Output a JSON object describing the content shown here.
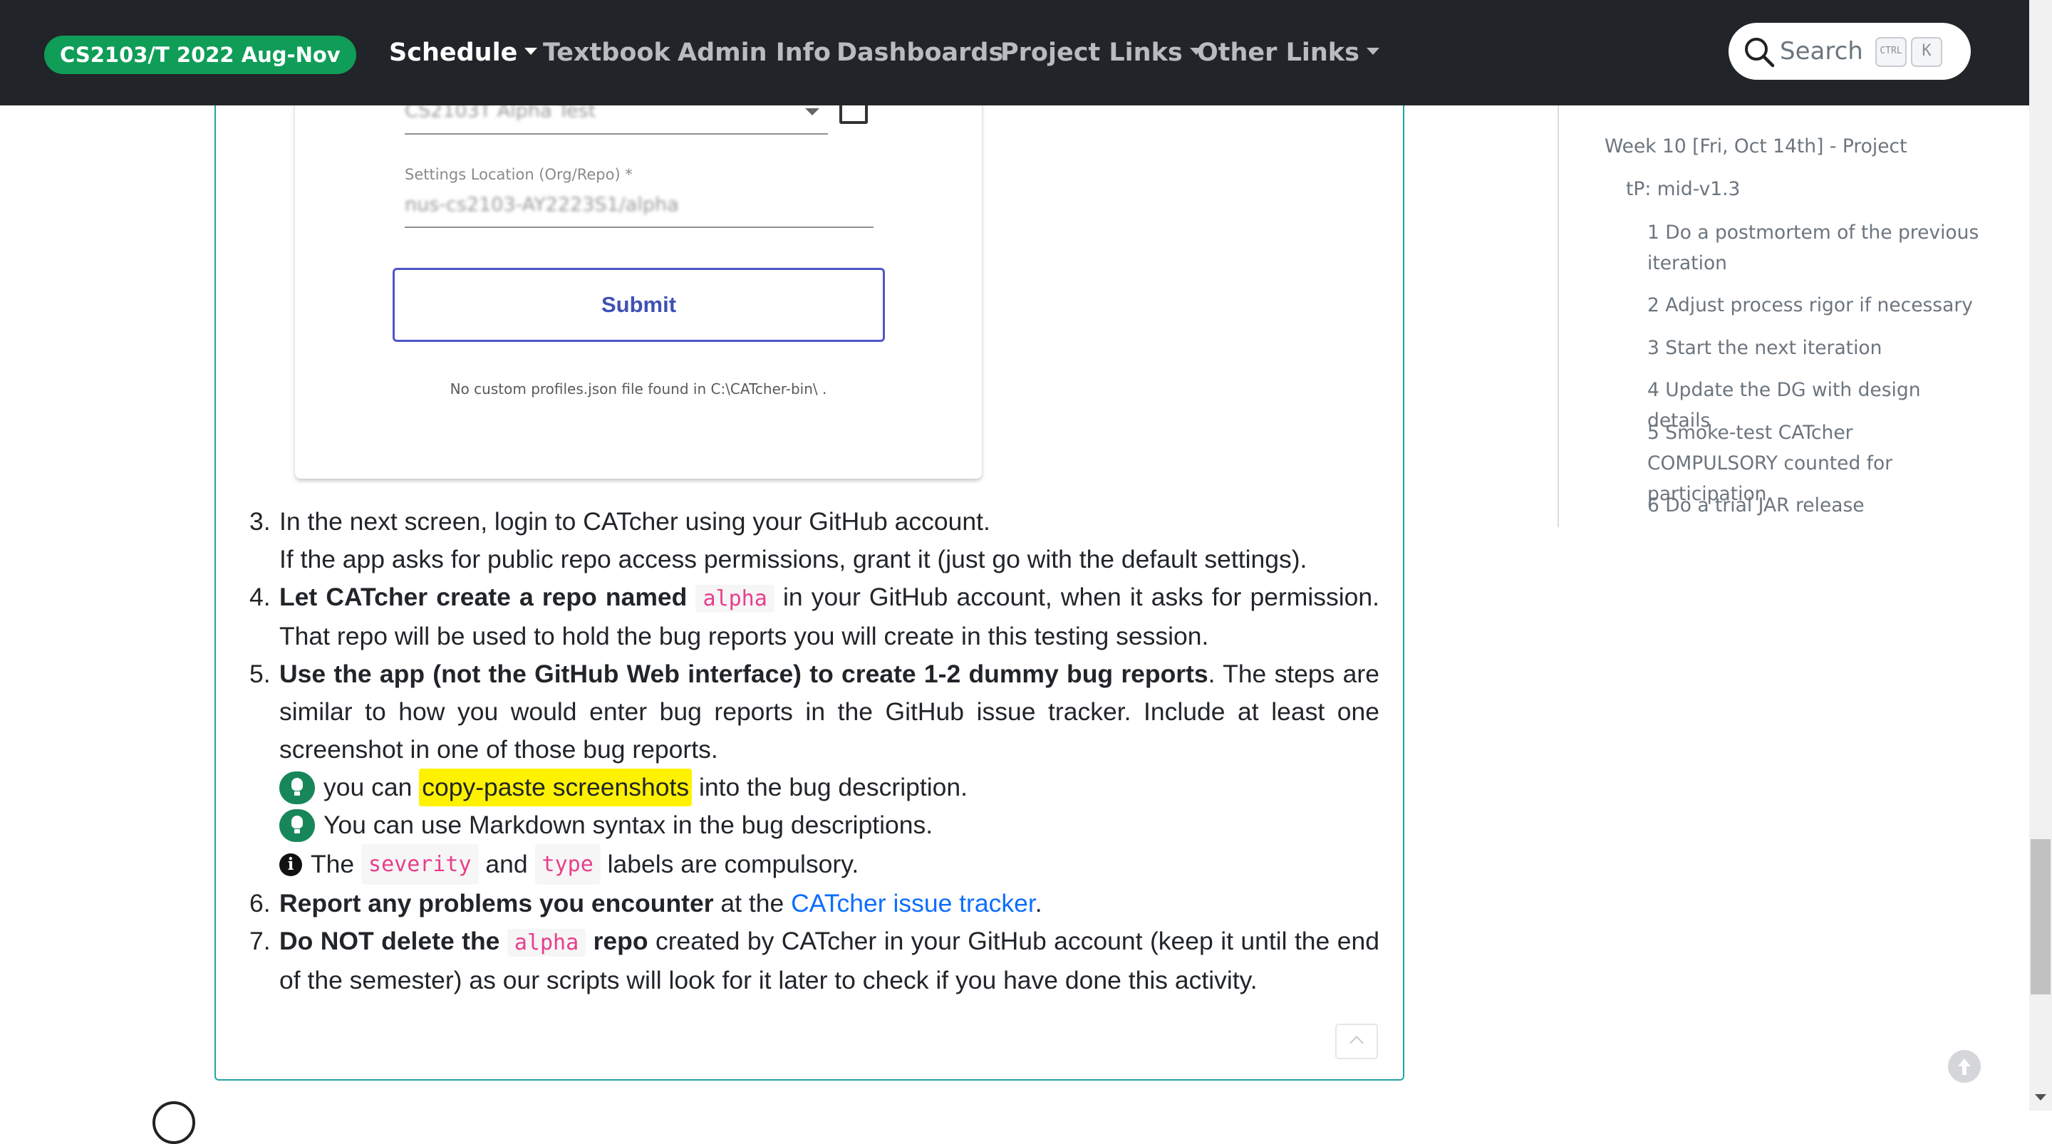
{
  "navbar": {
    "brand": "CS2103/T 2022 Aug-Nov",
    "items": [
      {
        "label": "Schedule",
        "dropdown": true,
        "active": true
      },
      {
        "label": "Textbook",
        "dropdown": false
      },
      {
        "label": "Admin Info",
        "dropdown": false
      },
      {
        "label": "Dashboards",
        "dropdown": false
      },
      {
        "label": "Project Links",
        "dropdown": true
      },
      {
        "label": "Other Links",
        "dropdown": true
      }
    ],
    "search": {
      "label": "Search",
      "kbd_ctrl": "CTRL",
      "kbd_key": "K"
    }
  },
  "screenshot": {
    "settings_label": "Settings Location (Org/Repo) *",
    "submit_label": "Submit",
    "profiles_note": "No custom profiles.json file found in C:\\CATcher-bin\\ ."
  },
  "steps": {
    "s3": {
      "num": "3.",
      "line1": "In the next screen, login to CATcher using your GitHub account.",
      "line2": "If the app asks for public repo access permissions, grant it (just go with the default settings)."
    },
    "s4": {
      "num": "4.",
      "bold": "Let CATcher create a repo named",
      "code": "alpha",
      "rest": "in your GitHub account, when it asks for permission. That repo will be used to hold the bug reports you will create in this testing session."
    },
    "s5": {
      "num": "5.",
      "bold": "Use the app (not the GitHub Web interface) to create 1-2 dummy bug reports",
      "rest": ". The steps are similar to how you would enter bug reports in the GitHub issue tracker. Include at least one screenshot in one of those bug reports.",
      "tip1_pre": "you can",
      "tip1_hl": "copy-paste screenshots",
      "tip1_post": "into the bug description.",
      "tip2": "You can use Markdown syntax in the bug descriptions.",
      "info_pre": "The",
      "info_code1": "severity",
      "info_mid": "and",
      "info_code2": "type",
      "info_post": "labels are compulsory."
    },
    "s6": {
      "num": "6.",
      "bold": "Report any problems you encounter",
      "mid": "at the",
      "link": "CATcher issue tracker",
      "end": "."
    },
    "s7": {
      "num": "7.",
      "bold_pre": "Do NOT delete the",
      "code": "alpha",
      "bold_post": "repo",
      "rest": "created by CATcher in your GitHub account (keep it until the end of the semester) as our scripts will look for it later to check if you have done this activity."
    }
  },
  "toc": {
    "items": [
      {
        "label": "Week 10 [Fri, Oct 14th] - Project",
        "level": 1
      },
      {
        "label": "tP: mid-v1.3",
        "level": 2
      },
      {
        "label": "1 Do a postmortem of the previous iteration",
        "level": 3
      },
      {
        "label": "2 Adjust process rigor if necessary",
        "level": 3
      },
      {
        "label": "3 Start the next iteration",
        "level": 3
      },
      {
        "label": "4 Update the DG with design details",
        "level": 3
      },
      {
        "label": "5 Smoke-test CATcher COMPULSORY counted for participation",
        "level": 3
      },
      {
        "label": "6 Do a trial JAR release",
        "level": 3
      }
    ]
  },
  "colors": {
    "navbar_bg": "#212529",
    "brand_bg": "#0f9d58",
    "card_border": "#24a3a3",
    "code_text": "#e83e8c",
    "highlight": "#fff200",
    "link": "#0d6efd",
    "tip_icon": "#17875a"
  },
  "icons": {
    "search": "search-icon",
    "tip": "lightbulb-icon",
    "info": "info-icon",
    "collapse": "chevron-up-icon",
    "back_to_top": "arrow-up-circle-icon"
  }
}
